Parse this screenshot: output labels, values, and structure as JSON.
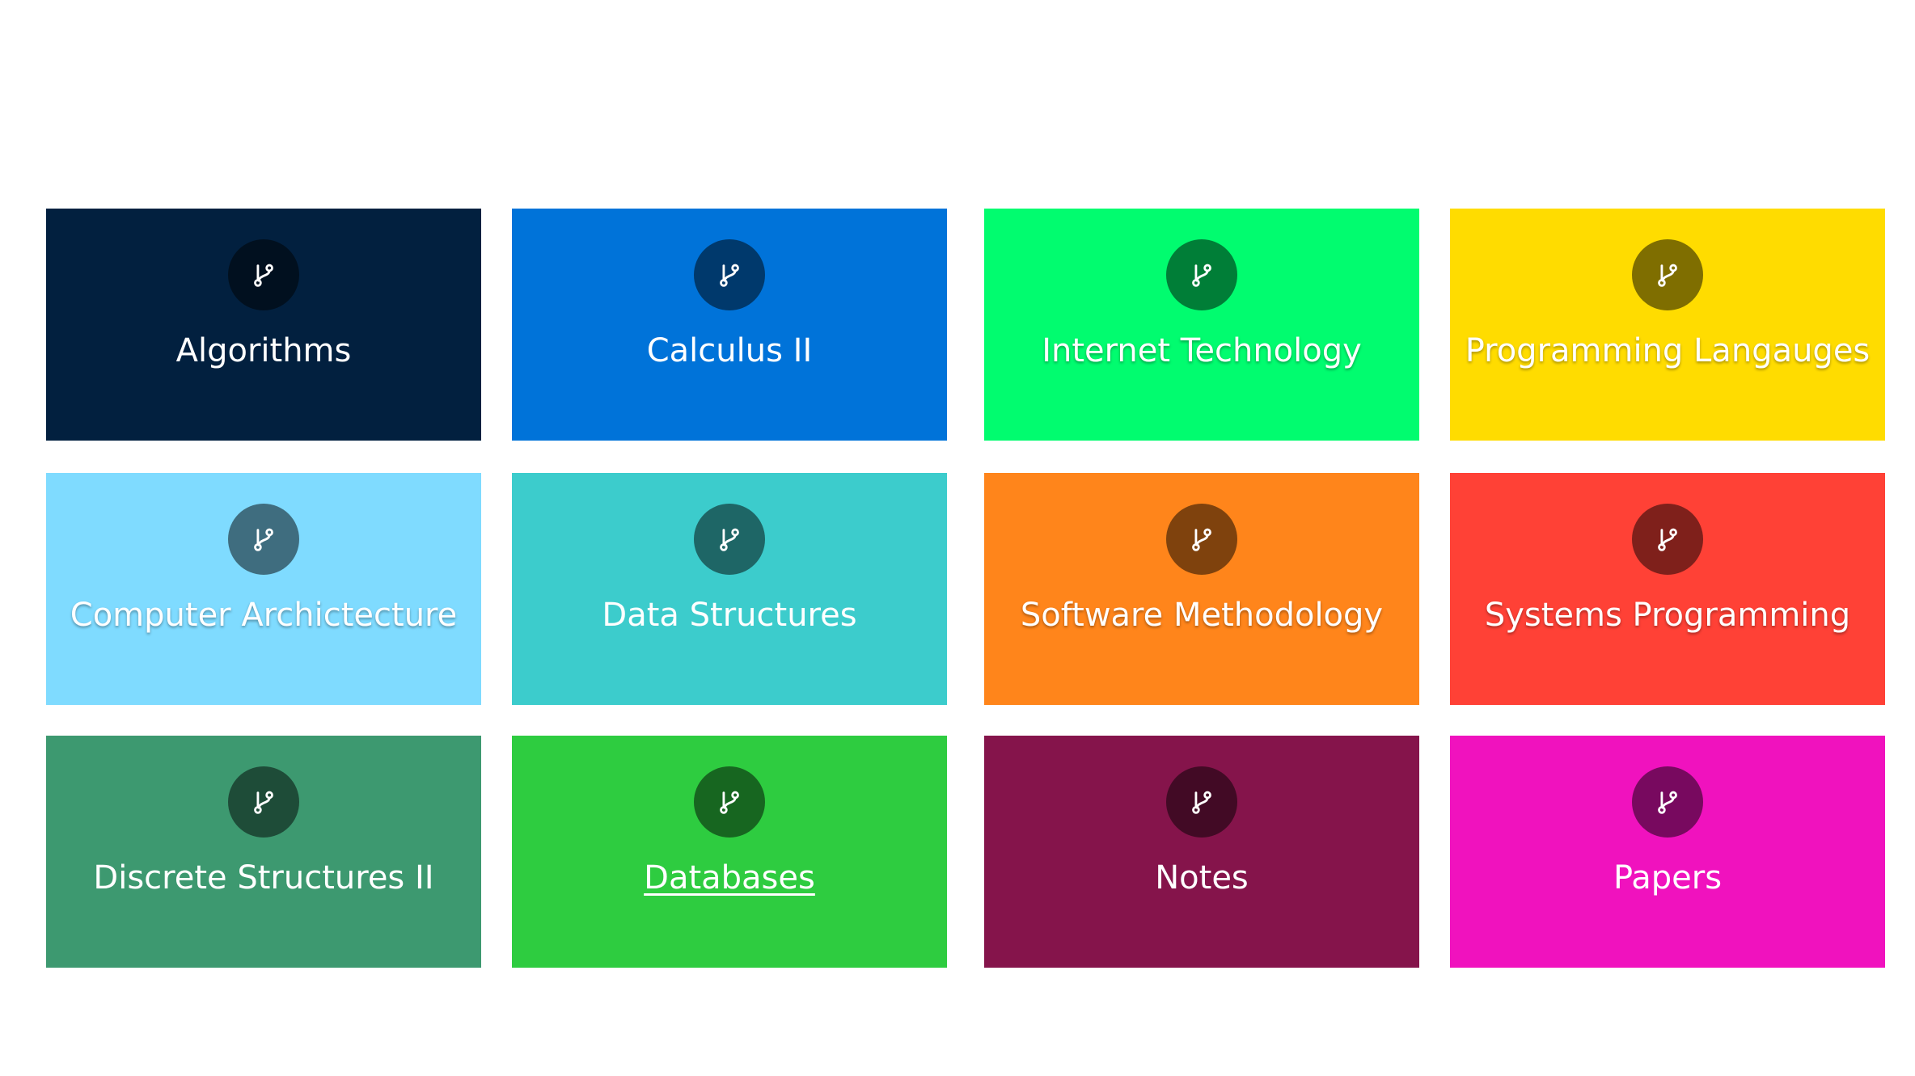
{
  "cards": [
    {
      "label": "Algorithms",
      "icon": "git-branch-icon",
      "color": "#02203f"
    },
    {
      "label": "Calculus II",
      "icon": "git-branch-icon",
      "color": "#0073d9"
    },
    {
      "label": "Internet Technology",
      "icon": "git-branch-icon",
      "color": "#01fc6f"
    },
    {
      "label": "Programming Langauges",
      "icon": "git-branch-icon",
      "color": "#ffdc00"
    },
    {
      "label": "Computer Archictecture",
      "icon": "git-branch-icon",
      "color": "#7fdbff"
    },
    {
      "label": "Data Structures",
      "icon": "git-branch-icon",
      "color": "#3ccccc"
    },
    {
      "label": "Software Methodology",
      "icon": "git-branch-icon",
      "color": "#ff851b"
    },
    {
      "label": "Systems Programming",
      "icon": "git-branch-icon",
      "color": "#ff4136"
    },
    {
      "label": "Discrete Structures II",
      "icon": "git-branch-icon",
      "color": "#3d9970"
    },
    {
      "label": "Databases",
      "icon": "git-branch-icon",
      "color": "#2ecc40"
    },
    {
      "label": "Notes",
      "icon": "git-branch-icon",
      "color": "#85144b"
    },
    {
      "label": "Papers",
      "icon": "git-branch-icon",
      "color": "#f012be"
    }
  ]
}
